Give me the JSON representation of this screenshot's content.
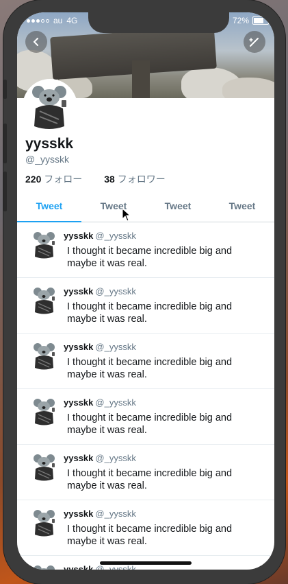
{
  "status": {
    "carrier": "au",
    "network": "4G",
    "battery": "72%"
  },
  "profile": {
    "name": "yysskk",
    "handle": "@_yysskk",
    "following_count": "220",
    "following_label": "フォロー",
    "followers_count": "38",
    "followers_label": "フォロワー"
  },
  "tabs": [
    {
      "label": "Tweet"
    },
    {
      "label": "Tweet"
    },
    {
      "label": "Tweet"
    },
    {
      "label": "Tweet"
    }
  ],
  "tweets": [
    {
      "name": "yysskk",
      "handle": "@_yysskk",
      "text": "I thought it became incredible big and maybe it was real."
    },
    {
      "name": "yysskk",
      "handle": "@_yysskk",
      "text": "I thought it became incredible big and maybe it was real."
    },
    {
      "name": "yysskk",
      "handle": "@_yysskk",
      "text": "I thought it became incredible big and maybe it was real."
    },
    {
      "name": "yysskk",
      "handle": "@_yysskk",
      "text": "I thought it became incredible big and maybe it was real."
    },
    {
      "name": "yysskk",
      "handle": "@_yysskk",
      "text": "I thought it became incredible big and maybe it was real."
    },
    {
      "name": "yysskk",
      "handle": "@_yysskk",
      "text": "I thought it became incredible big and maybe it was real."
    },
    {
      "name": "yysskk",
      "handle": "@_yysskk",
      "text": ""
    }
  ],
  "icons": {
    "back": "chevron-left-icon",
    "compose": "compose-tweet-icon"
  },
  "colors": {
    "accent": "#1da1f2",
    "secondary_text": "#657786"
  }
}
